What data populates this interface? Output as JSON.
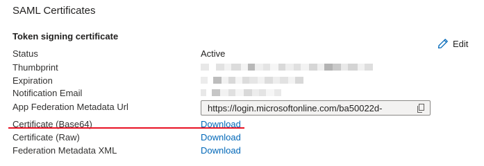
{
  "section": {
    "title": "SAML Certificates"
  },
  "certificate": {
    "title": "Token signing certificate",
    "edit_label": "Edit",
    "rows": [
      {
        "label": "Status",
        "value": "Active"
      },
      {
        "label": "Thumbprint"
      },
      {
        "label": "Expiration"
      },
      {
        "label": "Notification Email"
      },
      {
        "label": "App Federation Metadata Url",
        "value": "https://login.microsoftonline.com/ba50022d-"
      },
      {
        "label": "Certificate (Base64)",
        "link": "Download"
      },
      {
        "label": "Certificate (Raw)",
        "link": "Download"
      },
      {
        "label": "Federation Metadata XML",
        "link": "Download"
      }
    ]
  },
  "colors": {
    "link": "#0067b8",
    "highlight_underline": "#e81123",
    "redaction_light": "#e6e6e6",
    "redaction_dark": "#b3b3b3"
  },
  "icons": {
    "edit": "pencil-icon",
    "copy": "copy-icon"
  }
}
